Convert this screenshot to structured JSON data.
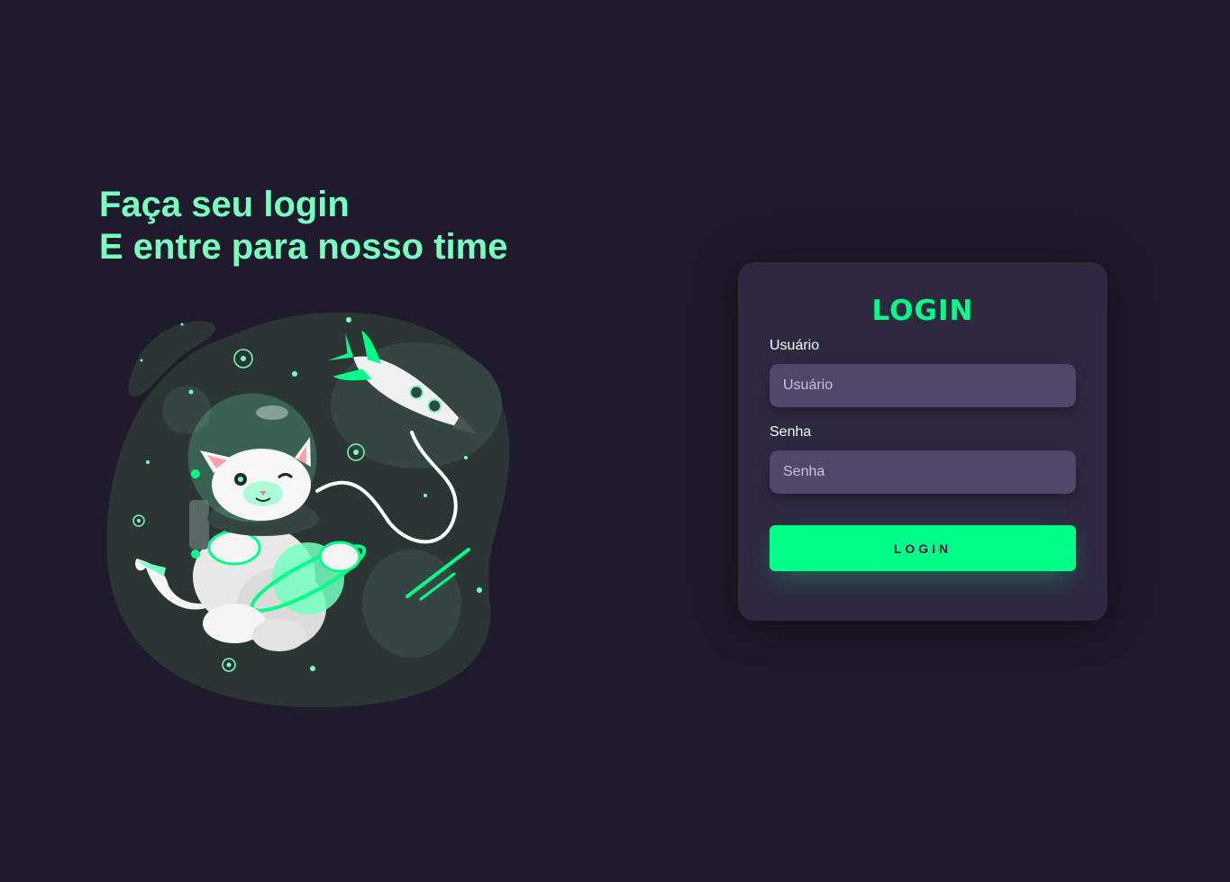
{
  "hero": {
    "line1": "Faça seu login",
    "line2": "E entre para nosso time"
  },
  "illustration": {
    "subject": "astronaut-cat-in-space",
    "icon": "astronaut-cat-illustration"
  },
  "login_card": {
    "title": "LOGIN",
    "username": {
      "label": "Usuário",
      "placeholder": "Usuário",
      "value": ""
    },
    "password": {
      "label": "Senha",
      "placeholder": "Senha",
      "value": ""
    },
    "submit_label": "LOGIN"
  },
  "colors": {
    "background": "#201b2c",
    "accent": "#00ff88",
    "headline": "#77ffc0",
    "card": "#2f2841",
    "input": "#514869"
  }
}
